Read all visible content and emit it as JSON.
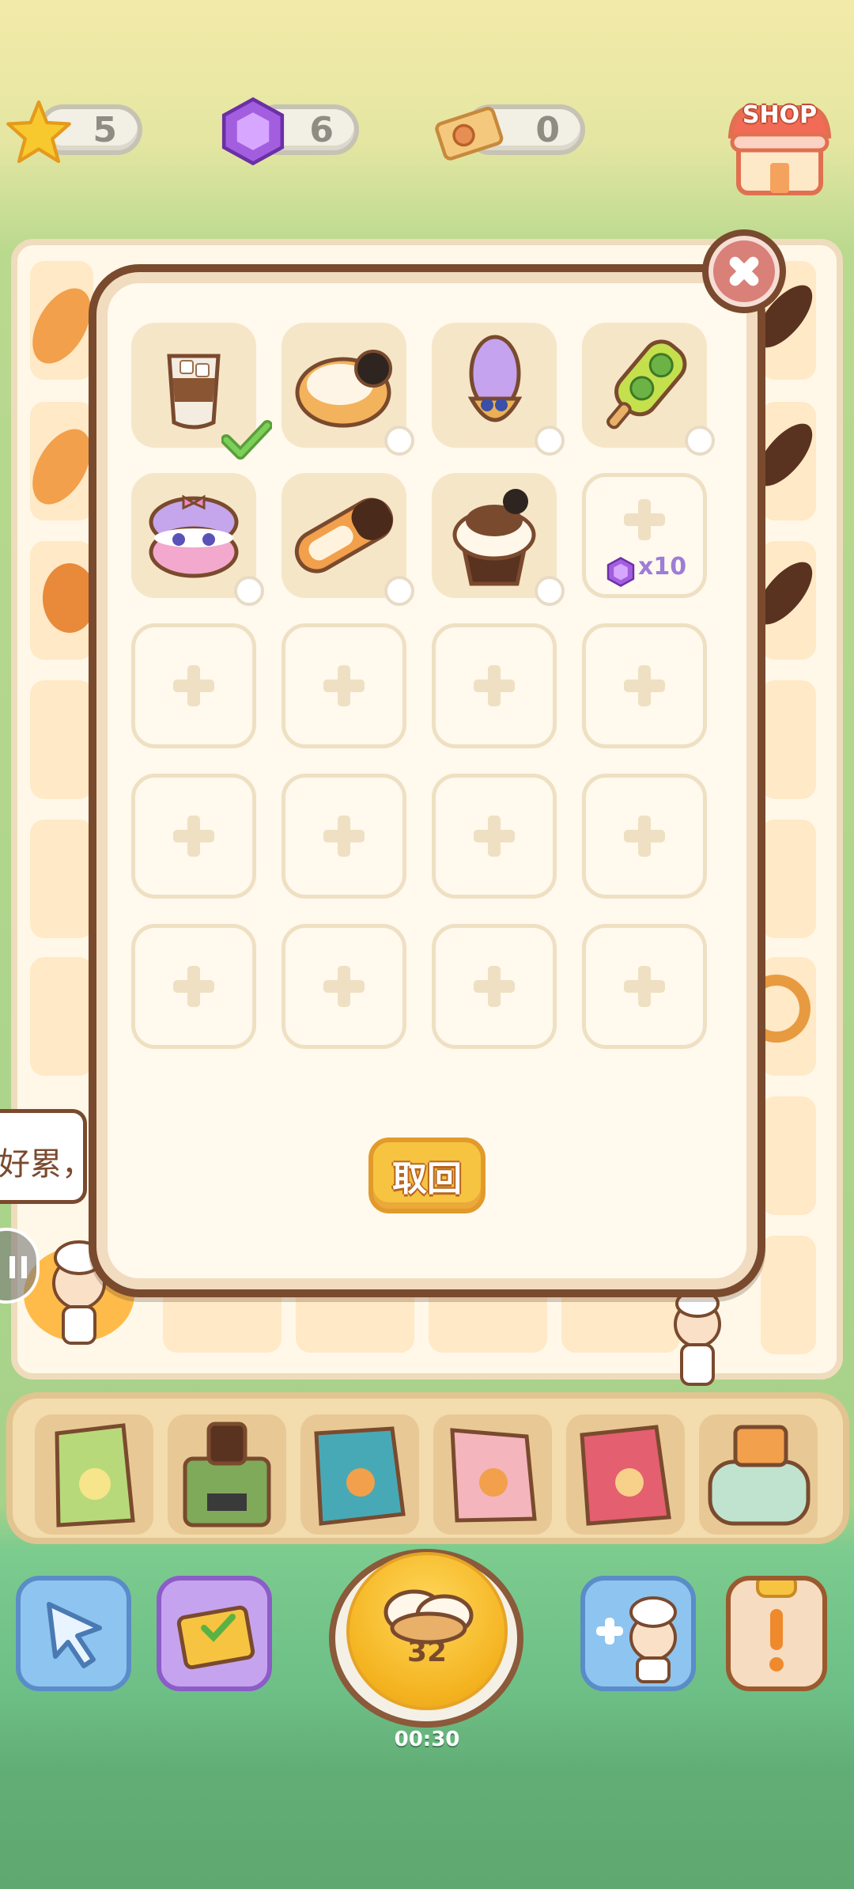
{
  "currencies": {
    "stars": "5",
    "gems": "6",
    "tickets": "0"
  },
  "shop": {
    "label": "SHOP"
  },
  "popup": {
    "items": [
      {
        "name": "iced-coffee",
        "selected": true
      },
      {
        "name": "cookie-donut",
        "selected": false
      },
      {
        "name": "taro-waffle-cone",
        "selected": false
      },
      {
        "name": "kiwi-popsicle",
        "selected": false
      },
      {
        "name": "macaron",
        "selected": false
      },
      {
        "name": "cannoli",
        "selected": false
      },
      {
        "name": "oreo-cupcake",
        "selected": false
      }
    ],
    "unlock_cost": "x10",
    "empty_slot_count": 12,
    "retrieve_label": "取回"
  },
  "speech_bubble": {
    "text": "好累，你"
  },
  "timer": {
    "count": "32",
    "time": "00:30"
  },
  "colors": {
    "popup_border": "#7a4a2e",
    "gem_purple": "#a35ee0",
    "gold": "#f6c441"
  }
}
